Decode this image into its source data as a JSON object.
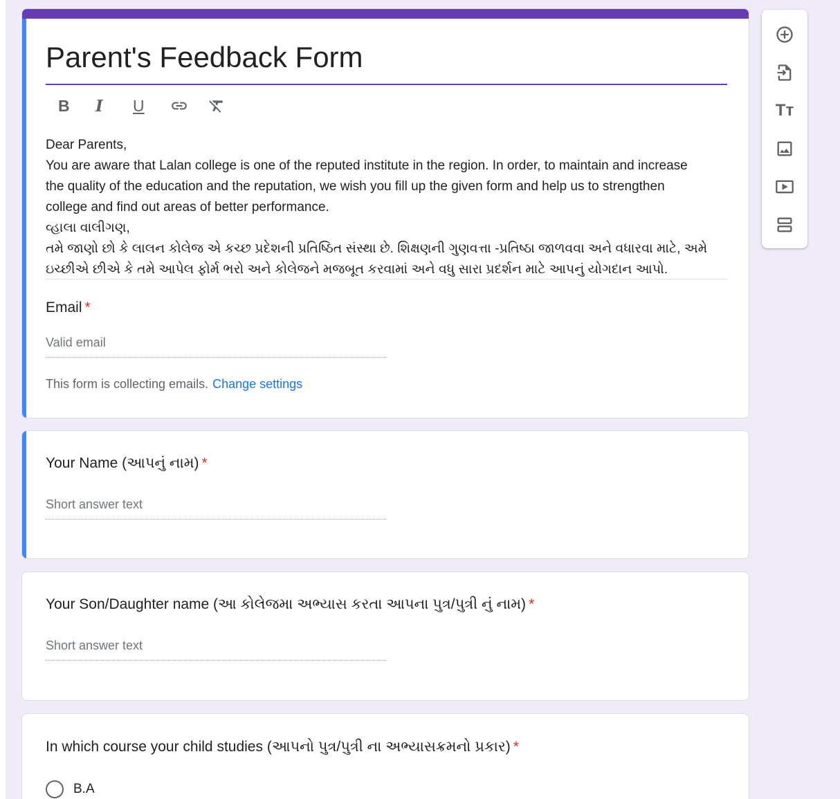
{
  "form": {
    "title": "Parent's Feedback Form",
    "toolbar": {
      "bold": "B",
      "italic": "I",
      "underline": "U"
    },
    "description_lines": [
      "Dear Parents,",
      "You are aware that Lalan college is one of the reputed institute in the region. In order, to maintain and increase",
      "the quality of the education and the reputation, we wish you fill up the given form and help us to strengthen",
      "college and find out areas of better performance.",
      "વ્હાલા વાલીગણ,",
      "તમે જાણો છો કે લાલન કોલેજ એ કચ્છ પ્રદેશની પ્રતિષ્ઠિત સંસ્થા છે. શિક્ષણની ગુણવત્તા -પ્રતિષ્ઠા જાળવવા અને વધારવા માટે, અમે",
      "ઇચ્છીએ છીએ કે તમે આપેલ ફોર્મ ભરો અને કોલેજને  મજબૂત કરવામાં અને વધુ સારા પ્રદર્શન માટે આપનું યોગદાન આપો."
    ],
    "email": {
      "label": "Email",
      "required_mark": "*",
      "placeholder": "Valid email",
      "helper_text": "This form is collecting emails.",
      "helper_link": "Change settings"
    }
  },
  "questions": [
    {
      "label": "Your Name (આપનું નામ)",
      "required_mark": "*",
      "placeholder": "Short answer text"
    },
    {
      "label": "Your Son/Daughter name (આ કોલેજમા અભ્યાસ કરતા આપના પુત્ર/પુત્રી નું નામ)",
      "required_mark": "*",
      "placeholder": "Short answer text"
    },
    {
      "label": "In which course your child studies (આપનો પુત્ર/પુત્રી ના અભ્યાસક્રમનો પ્રકાર)",
      "required_mark": "*",
      "options": [
        "B.A"
      ]
    }
  ],
  "side_toolbar": {
    "icons": [
      "add-question-icon",
      "import-questions-icon",
      "add-title-icon",
      "add-image-icon",
      "add-video-icon",
      "add-section-icon"
    ],
    "title_icon_text": "Tт"
  },
  "colors": {
    "background": "#f0ebf8",
    "theme": "#673ab7",
    "active_indicator": "#4285f4",
    "required": "#d93025",
    "link": "#1a73e8"
  }
}
